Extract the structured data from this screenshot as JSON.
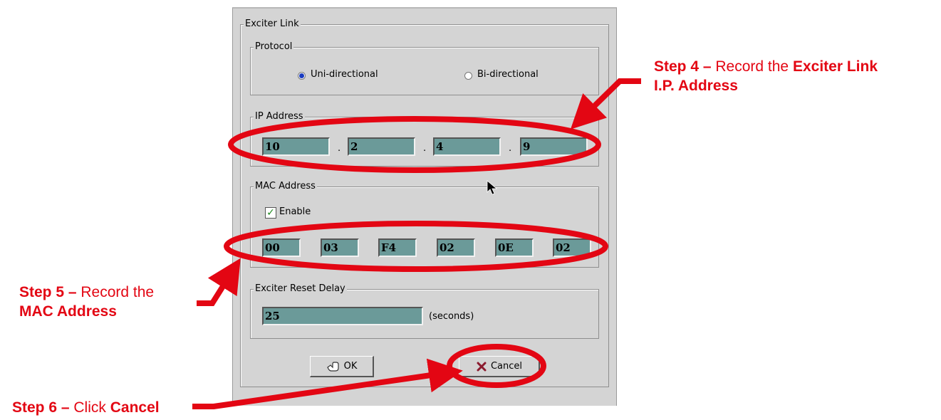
{
  "dialog": {
    "group_exciter_link": "Exciter Link",
    "protocol": {
      "legend": "Protocol",
      "options": [
        {
          "label": "Uni-directional",
          "selected": true
        },
        {
          "label": "Bi-directional",
          "selected": false
        }
      ]
    },
    "ip": {
      "legend": "IP Address",
      "octets": [
        "10",
        "2",
        "4",
        "9"
      ],
      "separator": "."
    },
    "mac": {
      "legend": "MAC Address",
      "enable_label": "Enable",
      "enable_checked": true,
      "bytes": [
        "00",
        "03",
        "F4",
        "02",
        "0E",
        "02"
      ]
    },
    "reset": {
      "legend": "Exciter Reset Delay",
      "value": "25",
      "unit": "(seconds)"
    },
    "ok_label": "OK",
    "cancel_label": "Cancel"
  },
  "annotations": {
    "step4": {
      "prefix": "Step 4 –",
      "text1": " Record the ",
      "bold1": "Exciter Link",
      "bold2": "I.P. Address"
    },
    "step5": {
      "prefix": "Step 5 –",
      "text1": " Record the",
      "bold1": "MAC Address"
    },
    "step6": {
      "prefix": "Step 6 –",
      "text1": " Click ",
      "bold1": "Cancel"
    }
  },
  "colors": {
    "annotation": "#e30613",
    "field": "#6b9a99",
    "radio_selected": "#1a3cc0"
  }
}
